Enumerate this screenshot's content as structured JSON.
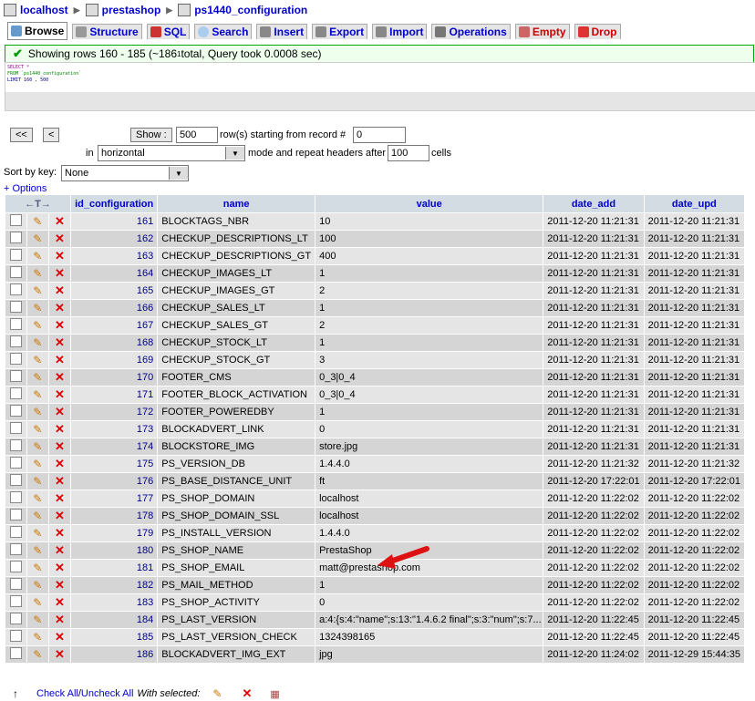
{
  "breadcrumb": {
    "server": "localhost",
    "database": "prestashop",
    "table": "ps1440_configuration"
  },
  "tabs": [
    "Browse",
    "Structure",
    "SQL",
    "Search",
    "Insert",
    "Export",
    "Import",
    "Operations",
    "Empty",
    "Drop"
  ],
  "message": "Showing rows 160 - 185 (~186",
  "message_sup": "1",
  "message_tail": " total, Query took 0.0008 sec)",
  "sql": {
    "line1": "SELECT *",
    "line2": "FROM `ps1440_configuration`",
    "line3": "LIMIT 160 , 500"
  },
  "nav": {
    "first": "<<",
    "prev": "<",
    "show_label": "Show :",
    "rows": "500",
    "rows_text": "row(s) starting from record #",
    "start": "0",
    "in_text": "in",
    "mode": "horizontal",
    "repeat_text": "mode and repeat headers after",
    "repeat": "100",
    "cells_text": "cells",
    "sortkey_label": "Sort by key:",
    "sortkey": "None",
    "options": "+ Options"
  },
  "columns": [
    "id_configuration",
    "name",
    "value",
    "date_add",
    "date_upd"
  ],
  "rows": [
    [
      "161",
      "BLOCKTAGS_NBR",
      "10",
      "2011-12-20 11:21:31",
      "2011-12-20 11:21:31"
    ],
    [
      "162",
      "CHECKUP_DESCRIPTIONS_LT",
      "100",
      "2011-12-20 11:21:31",
      "2011-12-20 11:21:31"
    ],
    [
      "163",
      "CHECKUP_DESCRIPTIONS_GT",
      "400",
      "2011-12-20 11:21:31",
      "2011-12-20 11:21:31"
    ],
    [
      "164",
      "CHECKUP_IMAGES_LT",
      "1",
      "2011-12-20 11:21:31",
      "2011-12-20 11:21:31"
    ],
    [
      "165",
      "CHECKUP_IMAGES_GT",
      "2",
      "2011-12-20 11:21:31",
      "2011-12-20 11:21:31"
    ],
    [
      "166",
      "CHECKUP_SALES_LT",
      "1",
      "2011-12-20 11:21:31",
      "2011-12-20 11:21:31"
    ],
    [
      "167",
      "CHECKUP_SALES_GT",
      "2",
      "2011-12-20 11:21:31",
      "2011-12-20 11:21:31"
    ],
    [
      "168",
      "CHECKUP_STOCK_LT",
      "1",
      "2011-12-20 11:21:31",
      "2011-12-20 11:21:31"
    ],
    [
      "169",
      "CHECKUP_STOCK_GT",
      "3",
      "2011-12-20 11:21:31",
      "2011-12-20 11:21:31"
    ],
    [
      "170",
      "FOOTER_CMS",
      "0_3|0_4",
      "2011-12-20 11:21:31",
      "2011-12-20 11:21:31"
    ],
    [
      "171",
      "FOOTER_BLOCK_ACTIVATION",
      "0_3|0_4",
      "2011-12-20 11:21:31",
      "2011-12-20 11:21:31"
    ],
    [
      "172",
      "FOOTER_POWEREDBY",
      "1",
      "2011-12-20 11:21:31",
      "2011-12-20 11:21:31"
    ],
    [
      "173",
      "BLOCKADVERT_LINK",
      "0",
      "2011-12-20 11:21:31",
      "2011-12-20 11:21:31"
    ],
    [
      "174",
      "BLOCKSTORE_IMG",
      "store.jpg",
      "2011-12-20 11:21:31",
      "2011-12-20 11:21:31"
    ],
    [
      "175",
      "PS_VERSION_DB",
      "1.4.4.0",
      "2011-12-20 11:21:32",
      "2011-12-20 11:21:32"
    ],
    [
      "176",
      "PS_BASE_DISTANCE_UNIT",
      "ft",
      "2011-12-20 17:22:01",
      "2011-12-20 17:22:01"
    ],
    [
      "177",
      "PS_SHOP_DOMAIN",
      "localhost",
      "2011-12-20 11:22:02",
      "2011-12-20 11:22:02"
    ],
    [
      "178",
      "PS_SHOP_DOMAIN_SSL",
      "localhost",
      "2011-12-20 11:22:02",
      "2011-12-20 11:22:02"
    ],
    [
      "179",
      "PS_INSTALL_VERSION",
      "1.4.4.0",
      "2011-12-20 11:22:02",
      "2011-12-20 11:22:02"
    ],
    [
      "180",
      "PS_SHOP_NAME",
      "PrestaShop",
      "2011-12-20 11:22:02",
      "2011-12-20 11:22:02"
    ],
    [
      "181",
      "PS_SHOP_EMAIL",
      "matt@prestashop.com",
      "2011-12-20 11:22:02",
      "2011-12-20 11:22:02"
    ],
    [
      "182",
      "PS_MAIL_METHOD",
      "1",
      "2011-12-20 11:22:02",
      "2011-12-20 11:22:02"
    ],
    [
      "183",
      "PS_SHOP_ACTIVITY",
      "0",
      "2011-12-20 11:22:02",
      "2011-12-20 11:22:02"
    ],
    [
      "184",
      "PS_LAST_VERSION",
      "a:4:{s:4:\"name\";s:13:\"1.4.6.2 final\";s:3:\"num\";s:7...",
      "2011-12-20 11:22:45",
      "2011-12-20 11:22:45"
    ],
    [
      "185",
      "PS_LAST_VERSION_CHECK",
      "1324398165",
      "2011-12-20 11:22:45",
      "2011-12-20 11:22:45"
    ],
    [
      "186",
      "BLOCKADVERT_IMG_EXT",
      "jpg",
      "2011-12-20 11:24:02",
      "2011-12-29 15:44:35"
    ]
  ],
  "footer": {
    "check_all": "Check All",
    "slash": " / ",
    "uncheck_all": "Uncheck All",
    "with_selected": "With selected:"
  }
}
